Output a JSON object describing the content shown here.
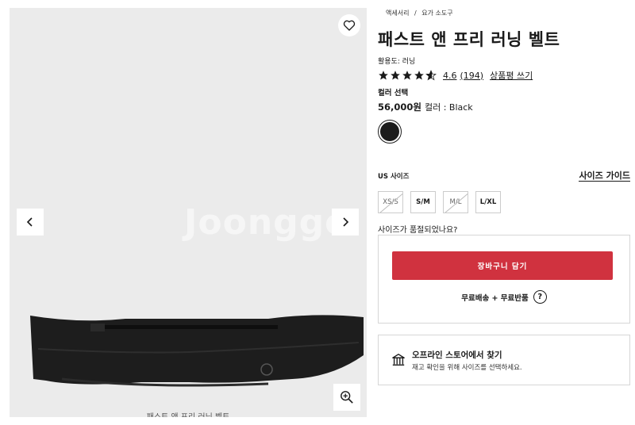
{
  "gallery": {
    "caption": "패스트 앤 프리 러닝 벨트",
    "watermark": "Joonggo",
    "icons": {
      "wishlist": "heart-icon",
      "prev": "chevron-left-icon",
      "next": "chevron-right-icon",
      "zoom": "zoom-in-icon"
    }
  },
  "breadcrumb": {
    "level1": "액세서리",
    "separator": "/",
    "level2": "요가 소도구"
  },
  "product": {
    "title": "패스트 앤 프리 러닝 벨트",
    "activity": "활용도: 러닝",
    "rating": "4.6",
    "review_count": "(194)",
    "write_review": "상품평 쓰기",
    "stars": 4.6
  },
  "color": {
    "label": "컬러 선택",
    "price": "56,000원",
    "color_text": "컬러 : Black",
    "swatch_hex": "#1c1c1c"
  },
  "size": {
    "label": "US 사이즈",
    "guide": "사이즈 가이드",
    "options": [
      {
        "label": "XS/S",
        "available": false
      },
      {
        "label": "S/M",
        "available": true
      },
      {
        "label": "M/L",
        "available": false
      },
      {
        "label": "L/XL",
        "available": true
      }
    ],
    "fit_question": "사이즈가 품절되었나요?"
  },
  "cart": {
    "button": "장바구니 담기",
    "shipping": "무료배송 + 무료반품",
    "help": "?",
    "accent": "#d0323f"
  },
  "store": {
    "title": "오프라인 스토어에서 찾기",
    "subtitle": "재고 확인을 위해 사이즈를 선택하세요."
  }
}
